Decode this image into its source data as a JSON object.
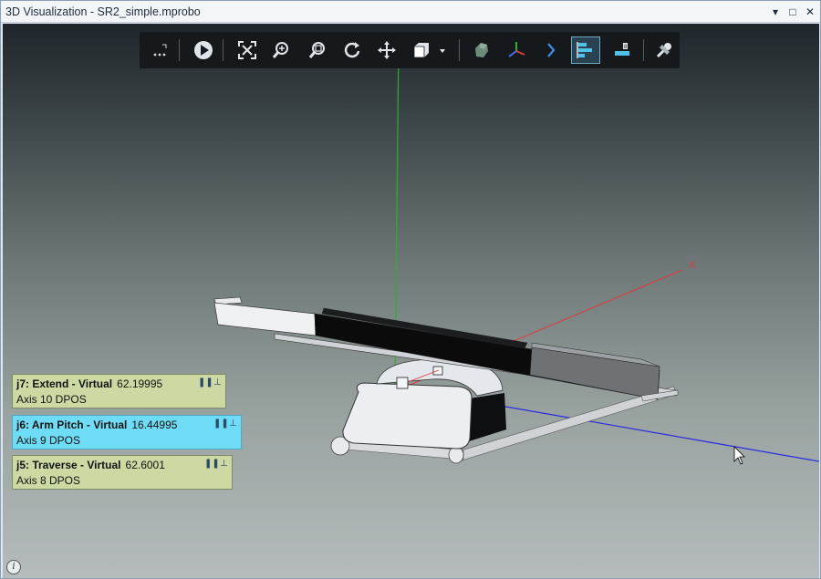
{
  "window": {
    "title": "3D Visualization - SR2_simple.mprobo",
    "controls": {
      "dropdown": "▾",
      "maximize": "□",
      "close": "✕"
    }
  },
  "toolbar": {
    "buttons": [
      {
        "name": "more-options",
        "icon": "ellipsis-icon"
      },
      {
        "name": "play",
        "icon": "play-icon"
      },
      {
        "name": "fit-all",
        "icon": "fit-all-icon"
      },
      {
        "name": "zoom",
        "icon": "zoom-icon"
      },
      {
        "name": "zoom-window",
        "icon": "zoom-window-icon"
      },
      {
        "name": "rotate",
        "icon": "rotate-icon"
      },
      {
        "name": "pan",
        "icon": "pan-icon"
      },
      {
        "name": "view-cube",
        "icon": "cube-icon"
      },
      {
        "name": "model",
        "icon": "model-icon"
      },
      {
        "name": "axes",
        "icon": "axes-icon"
      },
      {
        "name": "collapse",
        "icon": "chevron-right-icon"
      },
      {
        "name": "joint-panels",
        "icon": "joint-panels-icon",
        "active": true
      },
      {
        "name": "single-panel",
        "icon": "panel-icon"
      },
      {
        "name": "settings",
        "icon": "tools-icon"
      }
    ]
  },
  "axes": {
    "x_label": "X",
    "colors": {
      "x": "#e03a3a",
      "y": "#2bb02b",
      "z": "#2a2ae0"
    }
  },
  "joints": [
    {
      "name": "j7: Extend - Virtual",
      "value": "62.19995",
      "axis": "Axis 10  DPOS",
      "state": "inactive"
    },
    {
      "name": "j6: Arm Pitch - Virtual",
      "value": "16.44995",
      "axis": "Axis 9  DPOS",
      "state": "active"
    },
    {
      "name": "j5: Traverse - Virtual",
      "value": "62.6001",
      "axis": "Axis 8  DPOS",
      "state": "inactive"
    }
  ],
  "info": {
    "label": "i"
  }
}
